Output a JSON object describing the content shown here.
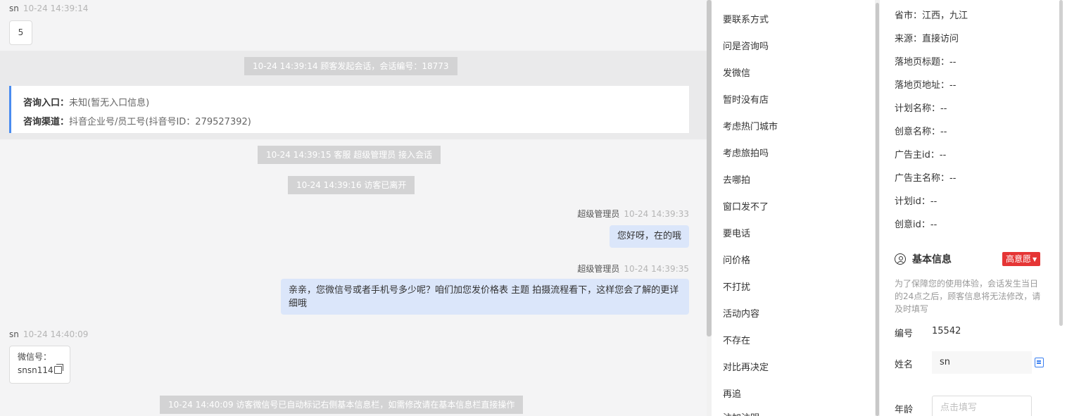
{
  "chat": {
    "messages": [
      {
        "sender": "sn",
        "time": "10-24 14:39:14",
        "text": "5"
      },
      {
        "sender": "超级管理员",
        "time": "10-24 14:39:33",
        "text": "您好呀，在的哦"
      },
      {
        "sender": "超级管理员",
        "time": "10-24 14:39:35",
        "text": "亲亲，您微信号或者手机号多少呢？咱们加您发价格表 主题 拍摄流程看下，这样您会了解的更详细哦"
      },
      {
        "sender": "sn",
        "time": "10-24 14:40:09",
        "label": "微信号：",
        "value": "snsn114"
      }
    ],
    "system": [
      "10-24 14:39:14 顾客发起会话，会话编号：18773",
      "10-24 14:39:15 客服 超级管理员 接入会话",
      "10-24 14:39:16 访客已离开",
      "10-24 14:40:09 访客微信号已自动标记右侧基本信息栏，如需修改请在基本信息栏直接操作"
    ],
    "consult": {
      "entry_key": "咨询入口：",
      "entry_val": "未知(暂无入口信息)",
      "channel_key": "咨询渠道：",
      "channel_val": "抖音企业号/员工号(抖音号ID：279527392)"
    }
  },
  "phrases": [
    "要联系方式",
    "问是咨询吗",
    "发微信",
    "暂时没有店",
    "考虑热门城市",
    "考虑旅拍吗",
    "去哪拍",
    "窗口发不了",
    "要电话",
    "问价格",
    "不打扰",
    "活动内容",
    "不存在",
    "对比再决定",
    "再追",
    "注加注明"
  ],
  "customer": {
    "fields": [
      {
        "label": "省市：",
        "value": "江西，九江"
      },
      {
        "label": "来源：",
        "value": "直接访问"
      },
      {
        "label": "落地页标题：",
        "value": "--"
      },
      {
        "label": "落地页地址：",
        "value": "--"
      },
      {
        "label": "计划名称：",
        "value": "--"
      },
      {
        "label": "创意名称：",
        "value": "--"
      },
      {
        "label": "广告主id：",
        "value": "--"
      },
      {
        "label": "广告主名称：",
        "value": "--"
      },
      {
        "label": "计划id：",
        "value": "--"
      },
      {
        "label": "创意id：",
        "value": "--"
      }
    ],
    "basic_title": "基本信息",
    "intent_tag": "高意愿",
    "hint": "为了保障您的使用体验，会话发生当日的24点之后，顾客信息将无法修改，请及时填写",
    "id_label": "编号",
    "id_value": "15542",
    "name_label": "姓名",
    "name_value": "sn",
    "age_label": "年龄",
    "age_placeholder": "点击填写"
  },
  "icons": [
    "copy-icon",
    "user-icon",
    "caret-down-icon",
    "edit-icon"
  ],
  "colors": {
    "accent": "#4a8cf0",
    "tag": "#e53535",
    "out_bubble": "#dbe6fa",
    "system": "#d3d3d4"
  }
}
